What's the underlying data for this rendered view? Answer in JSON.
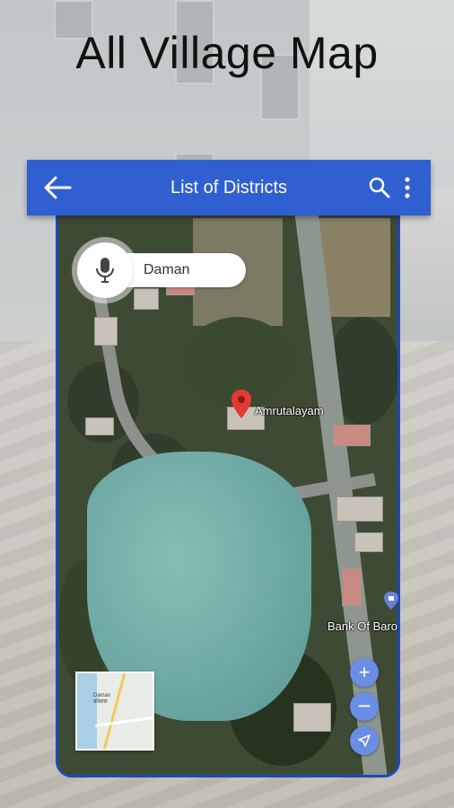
{
  "promo": {
    "headline": "All Village Map"
  },
  "appbar": {
    "title": "List of Districts",
    "back_icon": "arrow-left-icon",
    "search_icon": "search-icon",
    "more_icon": "more-vert-icon"
  },
  "search": {
    "value": "Daman",
    "mic_icon": "microphone-icon"
  },
  "map": {
    "place_label": "Amrutalayam",
    "poi_label": "Bank Of Baro",
    "minimap_label_1": "Daman",
    "minimap_label_2": "कोस्टल"
  },
  "controls": {
    "zoom_in": "+",
    "zoom_out": "−",
    "location_icon": "navigation-arrow-icon"
  },
  "colors": {
    "appbar": "#2f5fd0",
    "frame": "#1f48b8",
    "fab": "#6a8ee6"
  }
}
